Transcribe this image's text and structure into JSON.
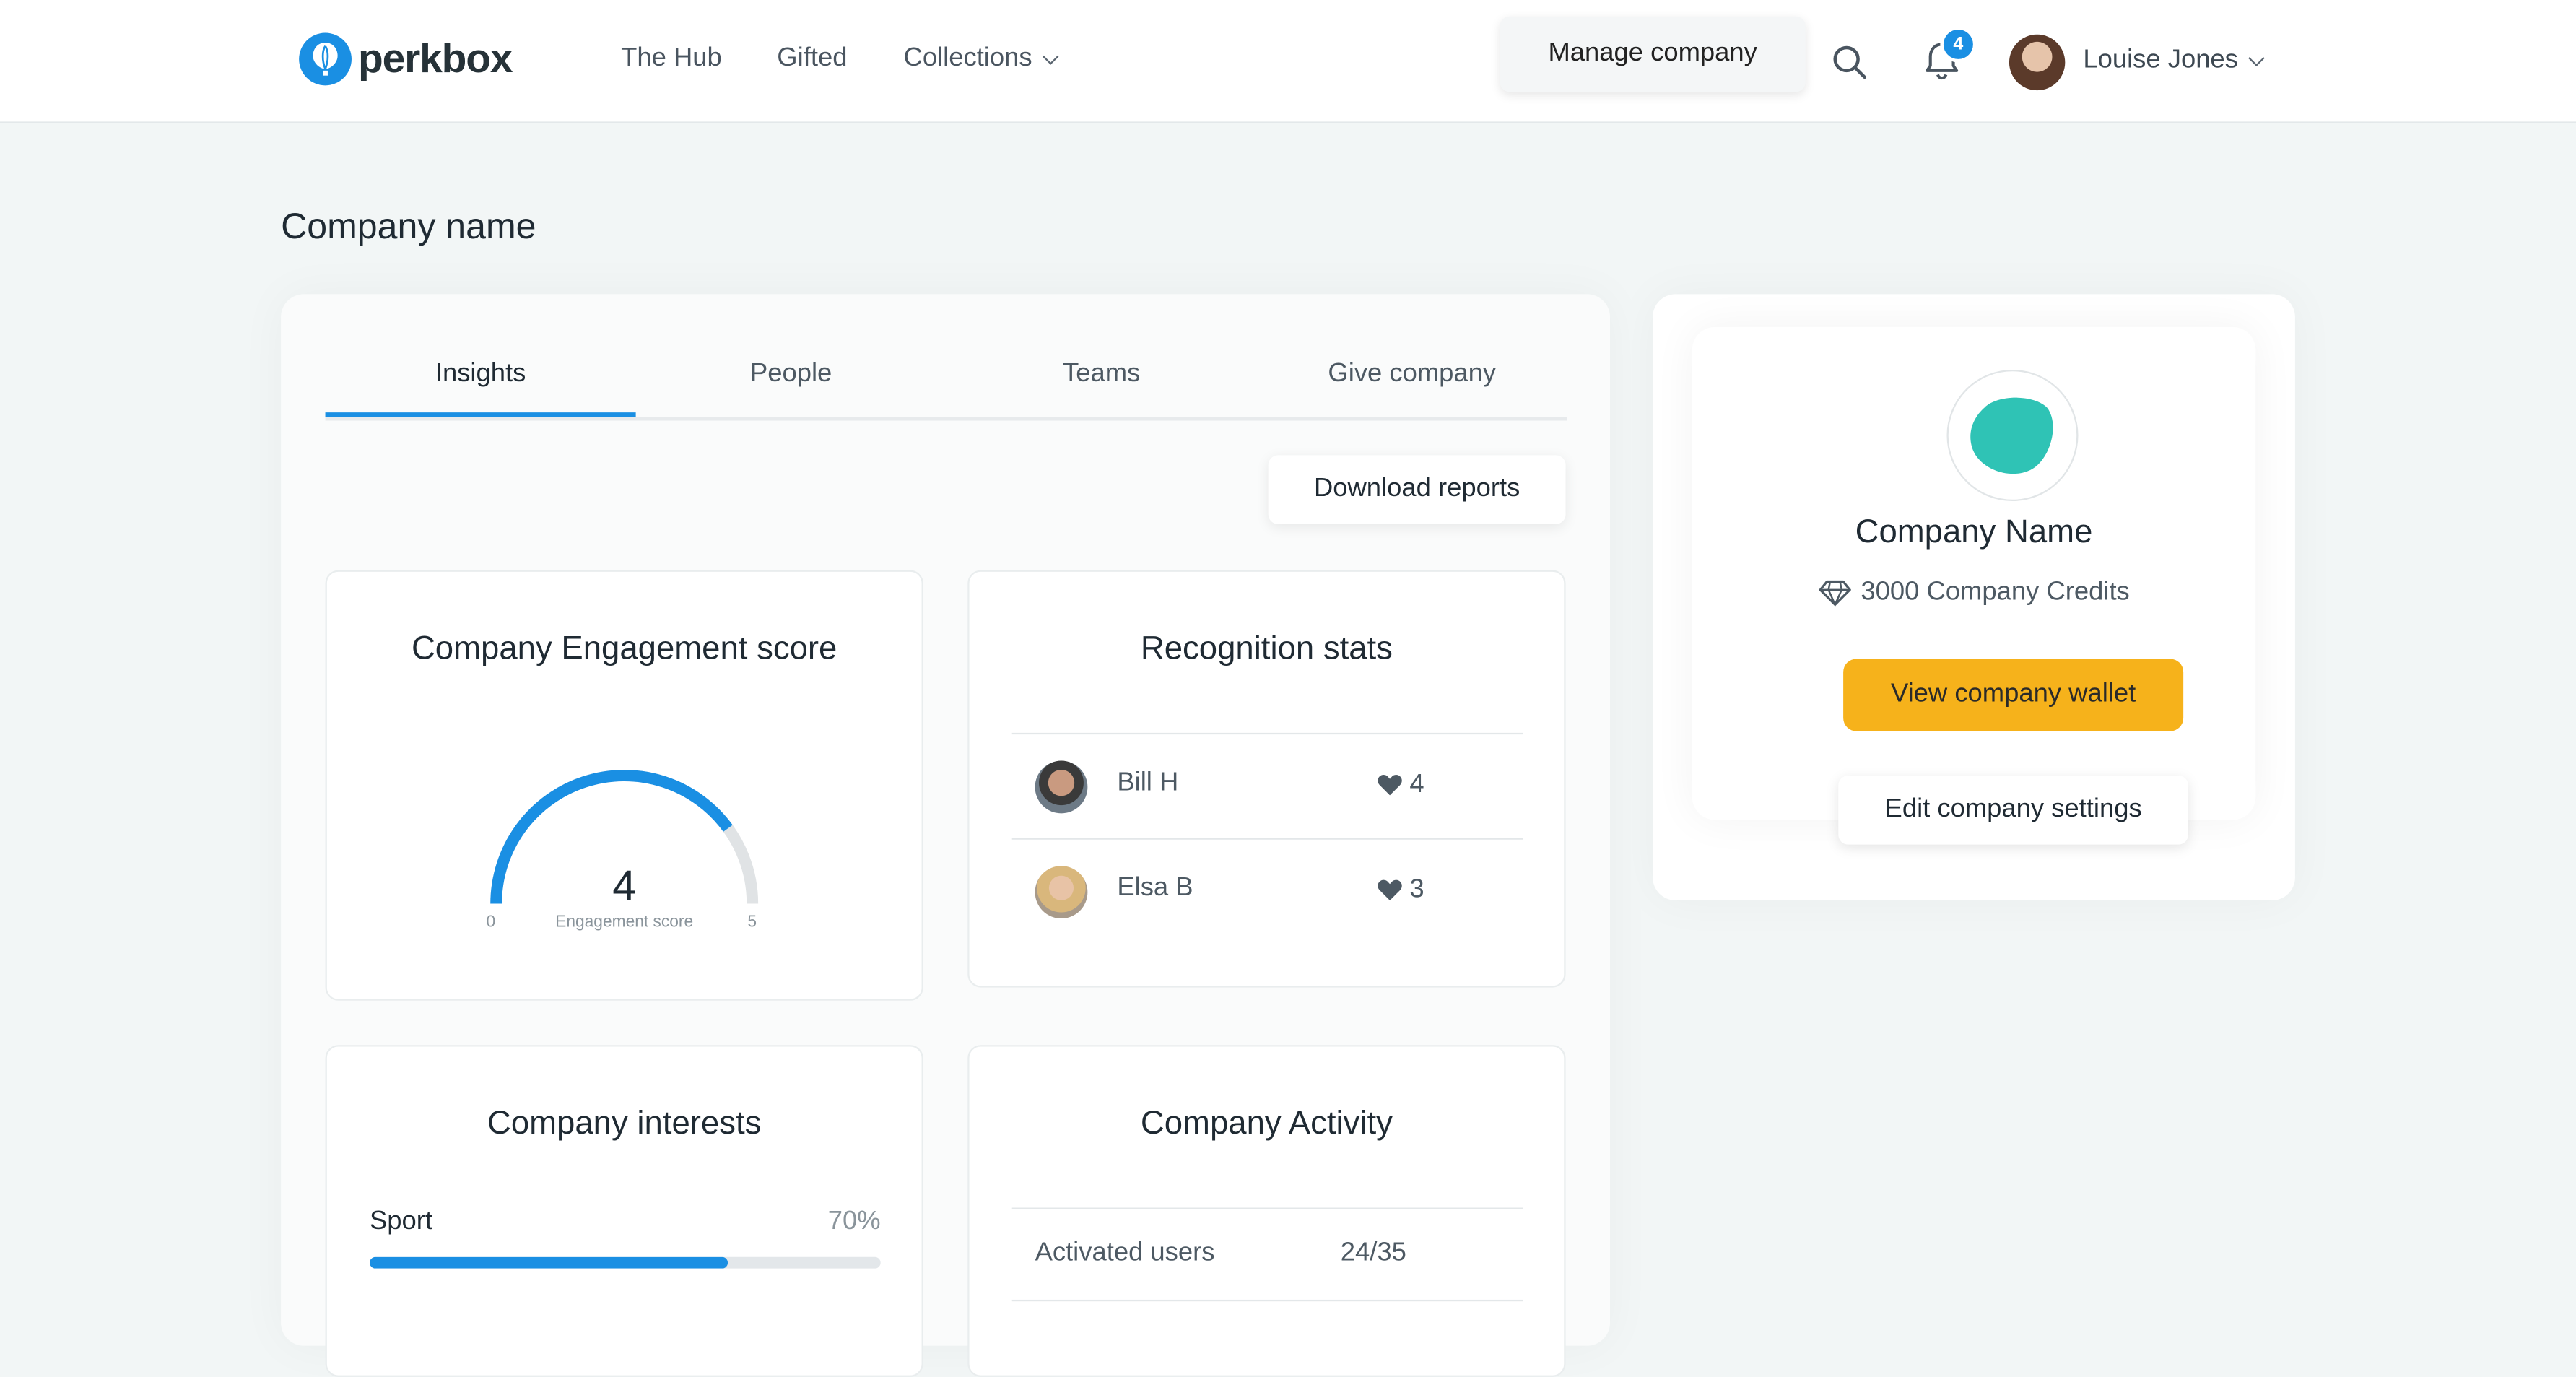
{
  "nav": {
    "brand": "perkbox",
    "links": [
      "The Hub",
      "Gifted",
      "Collections"
    ],
    "manage_label": "Manage company",
    "notifications_count": "4",
    "user_name": "Louise Jones"
  },
  "page": {
    "title": "Company name",
    "tabs": [
      "Insights",
      "People",
      "Teams",
      "Give company"
    ],
    "active_tab": "Insights",
    "download_label": "Download reports"
  },
  "engagement": {
    "title": "Company Engagement score",
    "score": "4",
    "min": "0",
    "max": "5",
    "label": "Engagement score",
    "score_value": 4,
    "max_value": 5
  },
  "recognition": {
    "title": "Recognition stats",
    "rows": [
      {
        "name": "Bill H",
        "count": "4"
      },
      {
        "name": "Elsa B",
        "count": "3"
      }
    ]
  },
  "interests": {
    "title": "Company interests",
    "rows": [
      {
        "label": "Sport",
        "pct": "70%",
        "value": 0.7
      }
    ]
  },
  "activity": {
    "title": "Company Activity",
    "rows": [
      {
        "label": "Activated users",
        "value": "24/35"
      }
    ]
  },
  "company": {
    "name": "Company Name",
    "credits": "3000 Company Credits",
    "wallet_label": "View company wallet",
    "settings_label": "Edit company settings"
  },
  "colors": {
    "accent": "#1a8fe3",
    "wallet": "#f6b21b",
    "logo": "#2fc3b5",
    "background": "#f2f6f6"
  }
}
